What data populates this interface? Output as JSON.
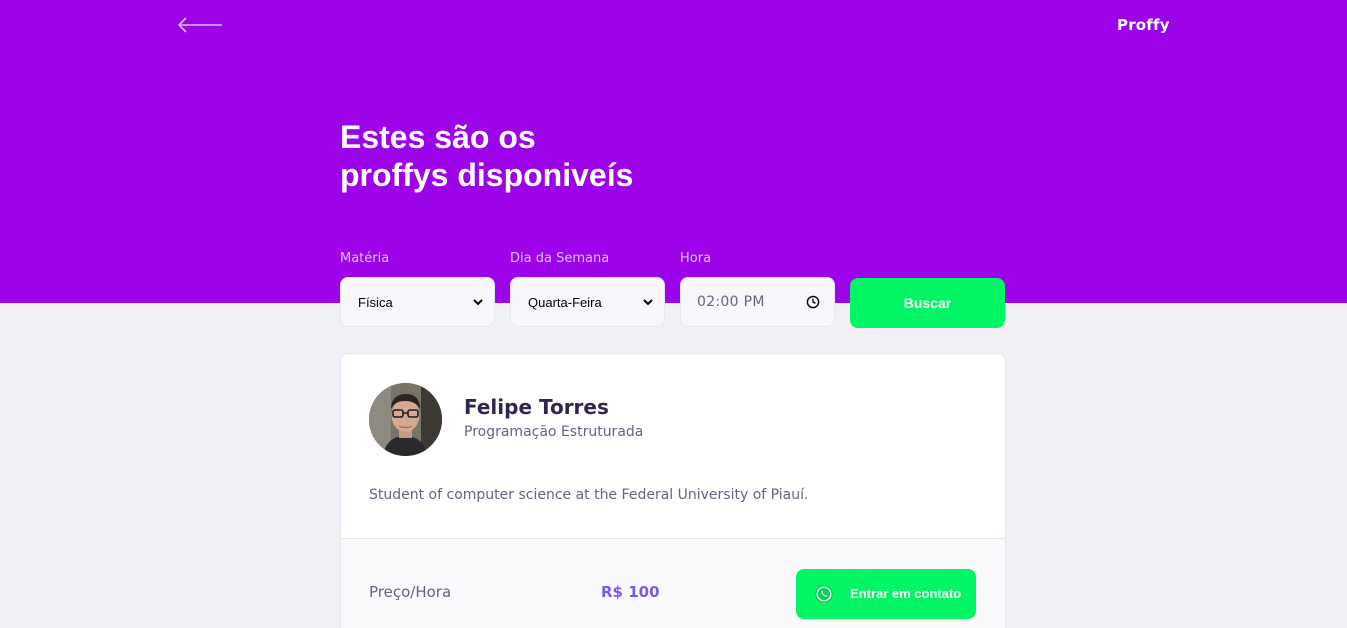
{
  "header": {
    "back_icon": "arrow-left-icon",
    "logo_text": "Proffy",
    "title_line1": "Estes são os",
    "title_line2": "proffys disponiveís"
  },
  "filters": {
    "subject": {
      "label": "Matéria",
      "value": "Física"
    },
    "week_day": {
      "label": "Dia da Semana",
      "value": "Quarta-Feira"
    },
    "time": {
      "label": "Hora",
      "value": "02:00 PM",
      "icon": "clock-icon"
    },
    "search_label": "Buscar"
  },
  "teacher": {
    "name": "Felipe Torres",
    "subject": "Programação Estruturada",
    "bio": "Student of computer science at the Federal University of Piauí.",
    "price_label": "Preço/Hora",
    "price_value": "R$ 100",
    "contact_label": "Entrar em contato",
    "contact_icon": "whatsapp-icon"
  },
  "colors": {
    "primary": "#9c03e8",
    "accent_green": "#04f564",
    "background": "#f0f0f7",
    "title_text": "#32264d",
    "body_text": "#6a6180",
    "price_text": "#8257e5"
  }
}
